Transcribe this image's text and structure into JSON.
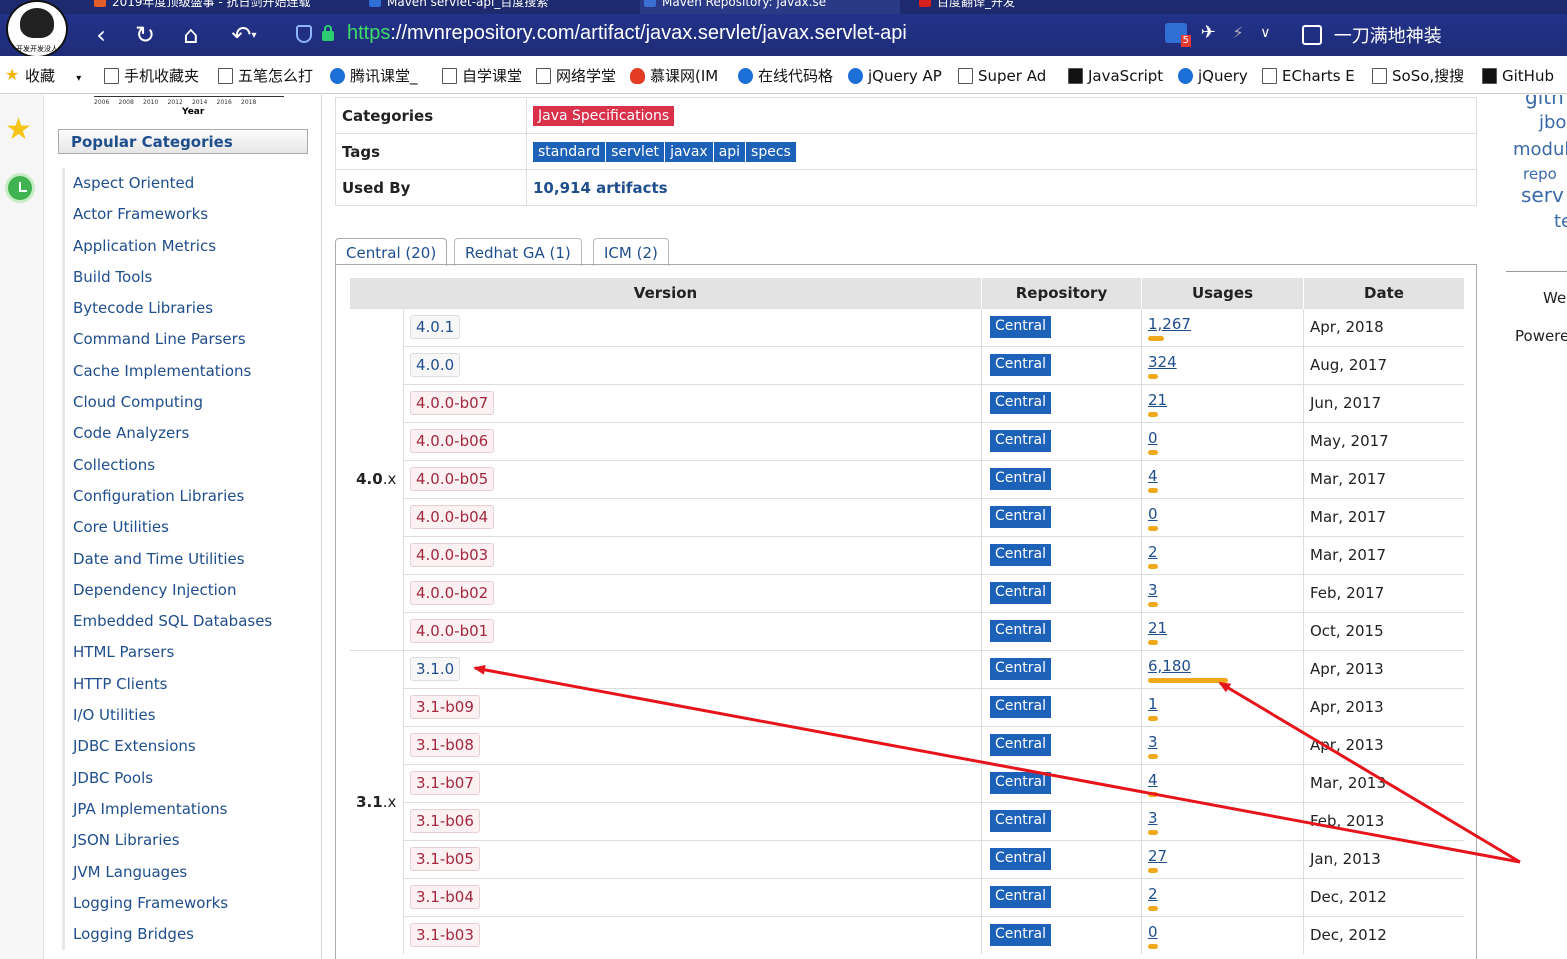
{
  "browser": {
    "tabs": [
      {
        "title": "2019年度顶级盛事 - 抗日剑开始连载",
        "active": false
      },
      {
        "title": "Maven servlet-api_百度搜索",
        "active": false
      },
      {
        "title": "Maven Repository: javax.se",
        "active": true
      },
      {
        "title": "百度翻译_开发",
        "active": false
      }
    ],
    "url_scheme": "https",
    "url_rest": "://mvnrepository.com/artifact/javax.servlet/javax.servlet-api",
    "ext_badge": "5",
    "profile_text": "一刀满地神装",
    "avatar_text": "开发开发没人"
  },
  "bookmarks": [
    {
      "label": "收藏",
      "icon": "star-icon"
    },
    {
      "label": "手机收藏夹",
      "icon": "phone-icon"
    },
    {
      "label": "五笔怎么打",
      "icon": "pen-icon"
    },
    {
      "label": "腾讯课堂_",
      "icon": "tencent-icon"
    },
    {
      "label": "自学课堂",
      "icon": "page-icon"
    },
    {
      "label": "网络学堂",
      "icon": "page-icon"
    },
    {
      "label": "慕课网(IM",
      "icon": "fire-icon"
    },
    {
      "label": "在线代码格",
      "icon": "globe-icon"
    },
    {
      "label": "jQuery AP",
      "icon": "jquery-icon"
    },
    {
      "label": "Super Ad",
      "icon": "page-icon"
    },
    {
      "label": "JavaScript",
      "icon": "js-icon"
    },
    {
      "label": "jQuery",
      "icon": "jquery-icon"
    },
    {
      "label": "ECharts E",
      "icon": "page-icon"
    },
    {
      "label": "SoSo,搜搜",
      "icon": "page-icon"
    },
    {
      "label": "GitHub",
      "icon": "github-icon"
    }
  ],
  "left": {
    "mini_chart_years": [
      "2006",
      "2008",
      "2010",
      "2012",
      "2014",
      "2016",
      "2018"
    ],
    "mini_chart_label": "Year",
    "popular_header": "Popular Categories",
    "categories": [
      "Aspect Oriented",
      "Actor Frameworks",
      "Application Metrics",
      "Build Tools",
      "Bytecode Libraries",
      "Command Line Parsers",
      "Cache Implementations",
      "Cloud Computing",
      "Code Analyzers",
      "Collections",
      "Configuration Libraries",
      "Core Utilities",
      "Date and Time Utilities",
      "Dependency Injection",
      "Embedded SQL Databases",
      "HTML Parsers",
      "HTTP Clients",
      "I/O Utilities",
      "JDBC Extensions",
      "JDBC Pools",
      "JPA Implementations",
      "JSON Libraries",
      "JVM Languages",
      "Logging Frameworks",
      "Logging Bridges"
    ]
  },
  "info": {
    "categories_label": "Categories",
    "categories_value": "Java Specifications",
    "tags_label": "Tags",
    "tags": [
      "standard",
      "servlet",
      "javax",
      "api",
      "specs"
    ],
    "used_by_label": "Used By",
    "used_by_value": "10,914 artifacts"
  },
  "repo_tabs": [
    "Central (20)",
    "Redhat GA (1)",
    "ICM (2)"
  ],
  "versions_table": {
    "headers": {
      "version": "Version",
      "repository": "Repository",
      "usages": "Usages",
      "date": "Date"
    },
    "groups": [
      {
        "major": "4.0",
        "suffix": ".x",
        "rows": [
          {
            "version": "4.0.1",
            "beta": false,
            "repo": "Central",
            "usages": "1,267",
            "usage_fraction": 0.205,
            "date": "Apr, 2018"
          },
          {
            "version": "4.0.0",
            "beta": false,
            "repo": "Central",
            "usages": "324",
            "usage_fraction": 0.052,
            "date": "Aug, 2017"
          },
          {
            "version": "4.0.0-b07",
            "beta": true,
            "repo": "Central",
            "usages": "21",
            "usage_fraction": 0.004,
            "date": "Jun, 2017"
          },
          {
            "version": "4.0.0-b06",
            "beta": true,
            "repo": "Central",
            "usages": "0",
            "usage_fraction": 0.0,
            "date": "May, 2017"
          },
          {
            "version": "4.0.0-b05",
            "beta": true,
            "repo": "Central",
            "usages": "4",
            "usage_fraction": 0.001,
            "date": "Mar, 2017"
          },
          {
            "version": "4.0.0-b04",
            "beta": true,
            "repo": "Central",
            "usages": "0",
            "usage_fraction": 0.0,
            "date": "Mar, 2017"
          },
          {
            "version": "4.0.0-b03",
            "beta": true,
            "repo": "Central",
            "usages": "2",
            "usage_fraction": 0.0,
            "date": "Mar, 2017"
          },
          {
            "version": "4.0.0-b02",
            "beta": true,
            "repo": "Central",
            "usages": "3",
            "usage_fraction": 0.0,
            "date": "Feb, 2017"
          },
          {
            "version": "4.0.0-b01",
            "beta": true,
            "repo": "Central",
            "usages": "21",
            "usage_fraction": 0.004,
            "date": "Oct, 2015"
          }
        ]
      },
      {
        "major": "3.1",
        "suffix": ".x",
        "rows": [
          {
            "version": "3.1.0",
            "beta": false,
            "repo": "Central",
            "usages": "6,180",
            "usage_fraction": 1.0,
            "date": "Apr, 2013"
          },
          {
            "version": "3.1-b09",
            "beta": true,
            "repo": "Central",
            "usages": "1",
            "usage_fraction": 0.0,
            "date": "Apr, 2013"
          },
          {
            "version": "3.1-b08",
            "beta": true,
            "repo": "Central",
            "usages": "3",
            "usage_fraction": 0.0,
            "date": "Apr, 2013"
          },
          {
            "version": "3.1-b07",
            "beta": true,
            "repo": "Central",
            "usages": "4",
            "usage_fraction": 0.001,
            "date": "Mar, 2013"
          },
          {
            "version": "3.1-b06",
            "beta": true,
            "repo": "Central",
            "usages": "3",
            "usage_fraction": 0.0,
            "date": "Feb, 2013"
          },
          {
            "version": "3.1-b05",
            "beta": true,
            "repo": "Central",
            "usages": "27",
            "usage_fraction": 0.004,
            "date": "Jan, 2013"
          },
          {
            "version": "3.1-b04",
            "beta": true,
            "repo": "Central",
            "usages": "2",
            "usage_fraction": 0.0,
            "date": "Dec, 2012"
          },
          {
            "version": "3.1-b03",
            "beta": true,
            "repo": "Central",
            "usages": "0",
            "usage_fraction": 0.0,
            "date": "Dec, 2012"
          }
        ]
      }
    ]
  },
  "right": {
    "tag_cloud": [
      "gith",
      "jbo",
      "modul",
      "repo",
      "serv",
      "te"
    ],
    "footer_lines": [
      "We",
      "Powere"
    ]
  },
  "colors": {
    "browser_bar": "#1f2c78",
    "category_badge": "#d9314a",
    "tag_badge": "#1d62b8",
    "usage_bar": "#f0a81c",
    "annotation_arrow": "#e8141c"
  }
}
